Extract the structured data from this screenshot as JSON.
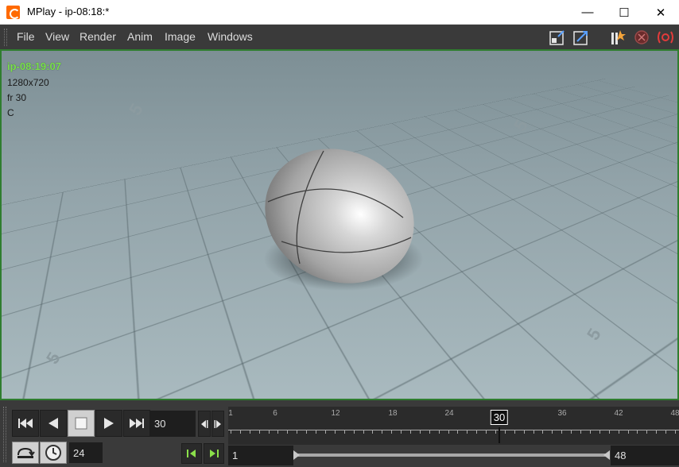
{
  "window": {
    "title": "MPlay - ip-08:18:*",
    "minimize_glyph": "—",
    "maximize_glyph": "☐",
    "close_glyph": "✕"
  },
  "menu": {
    "items": [
      "File",
      "View",
      "Render",
      "Anim",
      "Image",
      "Windows"
    ]
  },
  "toolbar_icons": [
    "snapshot-icon",
    "export-icon",
    "render-flipbook-icon",
    "stop-render-icon",
    "live-render-icon"
  ],
  "viewport": {
    "image_name": "ip-08:19:07",
    "resolution": "1280x720",
    "frame_label": "fr 30",
    "channel": "C",
    "accent_color": "#7be04a",
    "border_color": "#2f7d2f"
  },
  "transport": {
    "current_frame": "30",
    "fps": "24",
    "range_start": "1",
    "range_end": "48"
  },
  "timeline": {
    "ticks": [
      "1",
      "6",
      "12",
      "18",
      "24",
      "30",
      "36",
      "42",
      "48"
    ],
    "cursor_label": "30"
  }
}
